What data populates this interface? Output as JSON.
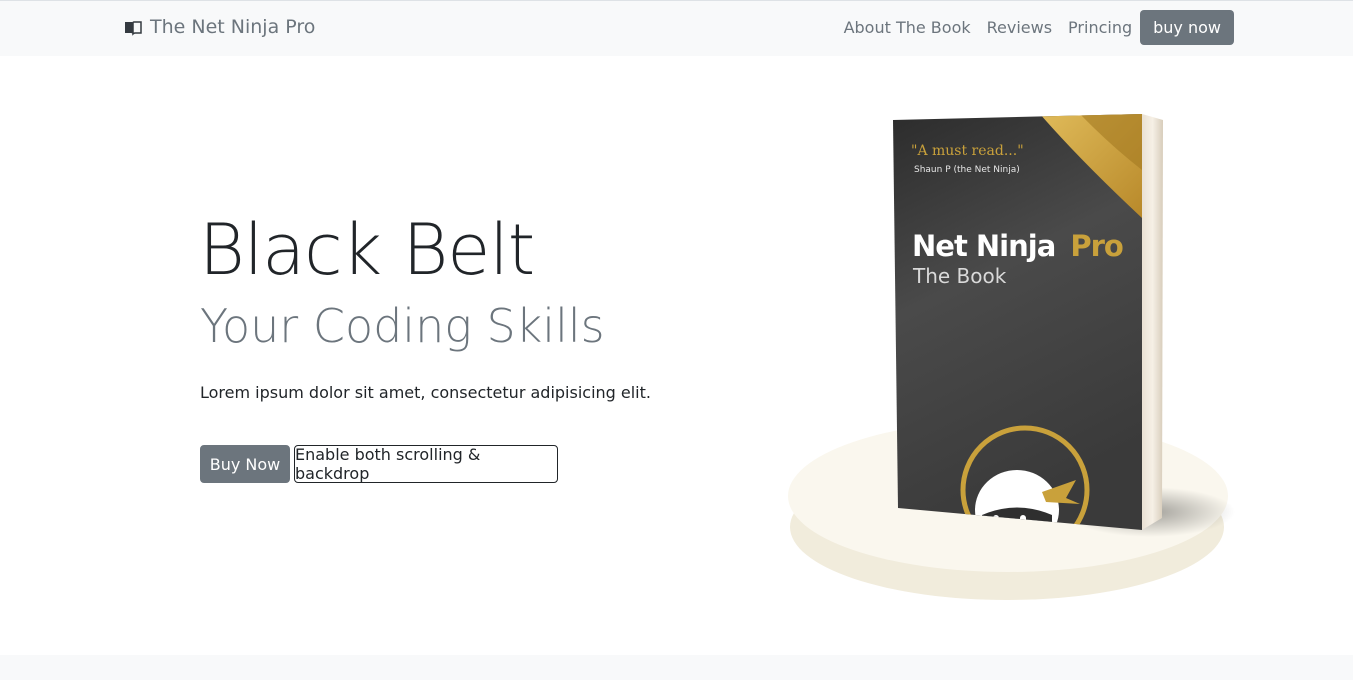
{
  "navbar": {
    "brand_icon": "book-icon",
    "brand": "The Net Ninja Pro",
    "links": [
      "About The Book",
      "Reviews",
      "Princing"
    ],
    "cta": "buy now"
  },
  "hero": {
    "title": "Black Belt",
    "subtitle": "Your Coding Skills",
    "lead": "Lorem ipsum dolor sit amet, consectetur adipisicing elit.",
    "buttons": {
      "primary": "Buy Now",
      "secondary": "Enable both scrolling & backdrop"
    }
  },
  "book": {
    "quote": "\"A must read...\"",
    "quote_author": "Shaun P (the Net Ninja)",
    "title_main": "Net Ninja",
    "title_accent": "Pro",
    "subtitle": "The Book",
    "accent_color": "#c9a13b"
  },
  "colors": {
    "navbar_bg": "#f8f9fa",
    "secondary": "#6c757d",
    "dark": "#212529"
  }
}
